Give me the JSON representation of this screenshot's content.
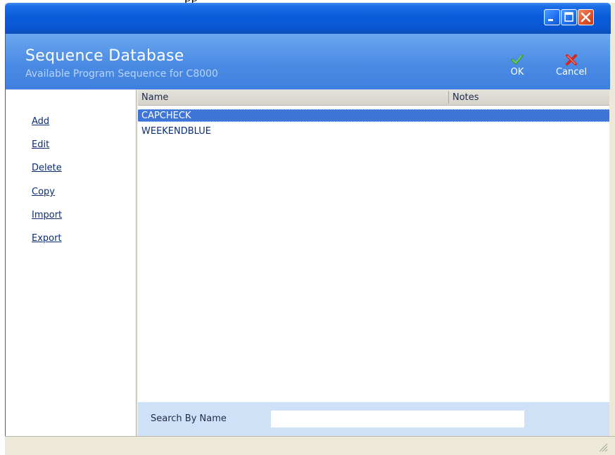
{
  "window": {
    "clipped_title": "pp"
  },
  "header": {
    "title": "Sequence Database",
    "subtitle": "Available Program Sequence for C8000",
    "ok_label": "OK",
    "cancel_label": "Cancel",
    "ok_icon": "check-icon",
    "cancel_icon": "x-icon",
    "ok_color": "#3aa12a",
    "cancel_color": "#d6281c"
  },
  "actions": {
    "add": "Add",
    "edit": "Edit",
    "delete": "Delete",
    "copy": "Copy",
    "import": "Import",
    "export": "Export"
  },
  "grid": {
    "columns": {
      "name": "Name",
      "notes": "Notes"
    },
    "rows": [
      {
        "name": "CAPCHECK",
        "notes": "",
        "selected": true
      },
      {
        "name": "WEEKENDBLUE",
        "notes": "",
        "selected": false
      }
    ]
  },
  "search": {
    "label": "Search By Name",
    "value": "",
    "placeholder": ""
  },
  "colors": {
    "titlebar": "#0a5ad8",
    "header": "#4a8be4",
    "selection": "#3d74d6",
    "search_bar": "#cfe1f7"
  }
}
